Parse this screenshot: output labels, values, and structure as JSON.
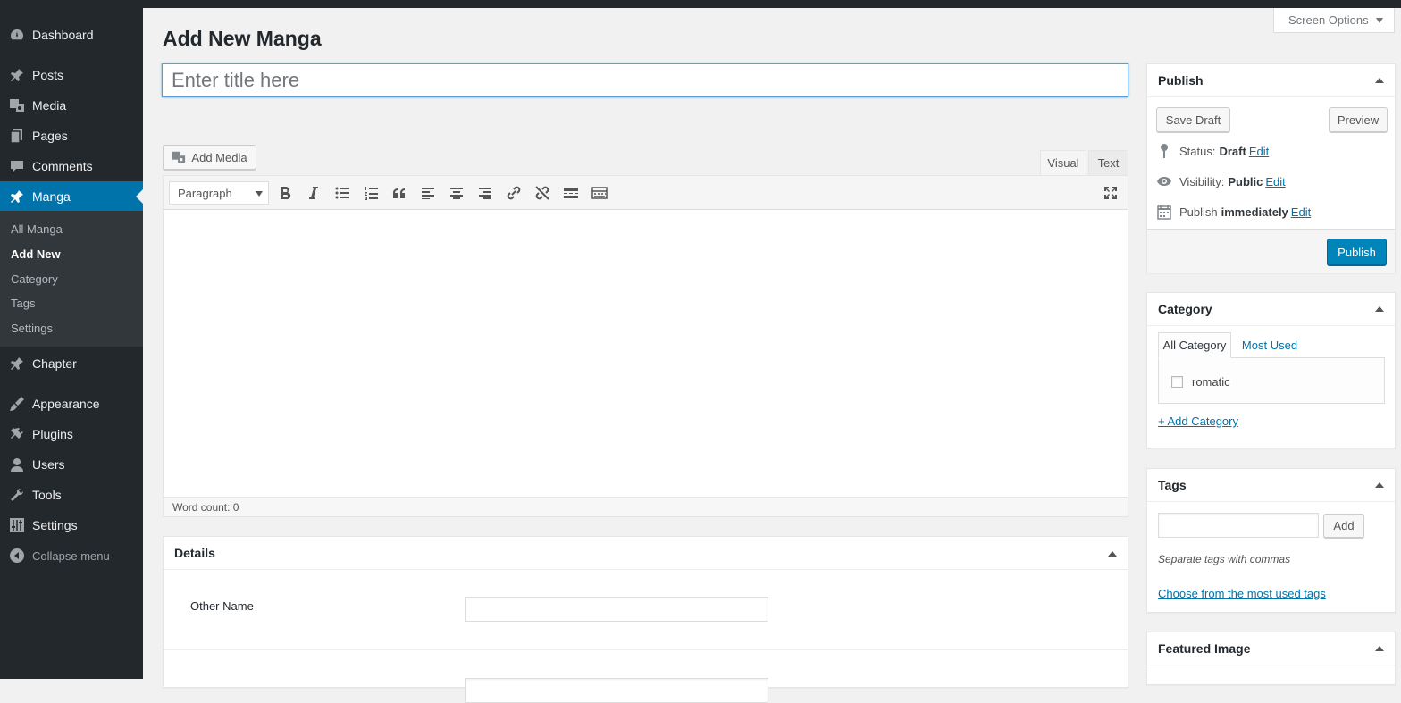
{
  "sidebar": {
    "items": [
      {
        "icon": "dashboard-icon",
        "label": "Dashboard"
      },
      {
        "icon": "pin-icon",
        "label": "Posts"
      },
      {
        "icon": "media-icon",
        "label": "Media"
      },
      {
        "icon": "pages-icon",
        "label": "Pages"
      },
      {
        "icon": "comments-icon",
        "label": "Comments"
      },
      {
        "icon": "pin-icon",
        "label": "Manga"
      },
      {
        "icon": "pin-icon",
        "label": "Chapter"
      },
      {
        "icon": "appearance-icon",
        "label": "Appearance"
      },
      {
        "icon": "plugins-icon",
        "label": "Plugins"
      },
      {
        "icon": "users-icon",
        "label": "Users"
      },
      {
        "icon": "tools-icon",
        "label": "Tools"
      },
      {
        "icon": "settings-icon",
        "label": "Settings"
      }
    ],
    "submenu": [
      "All Manga",
      "Add New",
      "Category",
      "Tags",
      "Settings"
    ],
    "collapse_label": "Collapse menu",
    "active_color": "#0073aa"
  },
  "screen_options": "Screen Options",
  "page": {
    "title": "Add New Manga",
    "title_placeholder": "Enter title here"
  },
  "editor": {
    "add_media": "Add Media",
    "tab_visual": "Visual",
    "tab_text": "Text",
    "format_select": "Paragraph",
    "toolbar_icons": [
      "bold-icon",
      "italic-icon",
      "bulleted-list-icon",
      "numbered-list-icon",
      "blockquote-icon",
      "align-left-icon",
      "align-center-icon",
      "align-right-icon",
      "link-icon",
      "unlink-icon",
      "read-more-icon",
      "toolbar-toggle-icon"
    ],
    "word_count": "Word count: 0"
  },
  "details": {
    "title": "Details",
    "other_name_label": "Other Name"
  },
  "publish": {
    "title": "Publish",
    "save_draft": "Save Draft",
    "preview": "Preview",
    "status_label": "Status:",
    "status_value": "Draft",
    "visibility_label": "Visibility:",
    "visibility_value": "Public",
    "publish_label": "Publish",
    "publish_value": "immediately",
    "edit": "Edit",
    "publish_button": "Publish",
    "primary_color": "#0085ba"
  },
  "category": {
    "title": "Category",
    "tab_all": "All Category",
    "tab_most_used": "Most Used",
    "items": [
      "romatic"
    ],
    "add_link": "+ Add Category"
  },
  "tags": {
    "title": "Tags",
    "add_button": "Add",
    "hint": "Separate tags with commas",
    "choose_link": "Choose from the most used tags"
  },
  "featured_image": {
    "title": "Featured Image"
  }
}
